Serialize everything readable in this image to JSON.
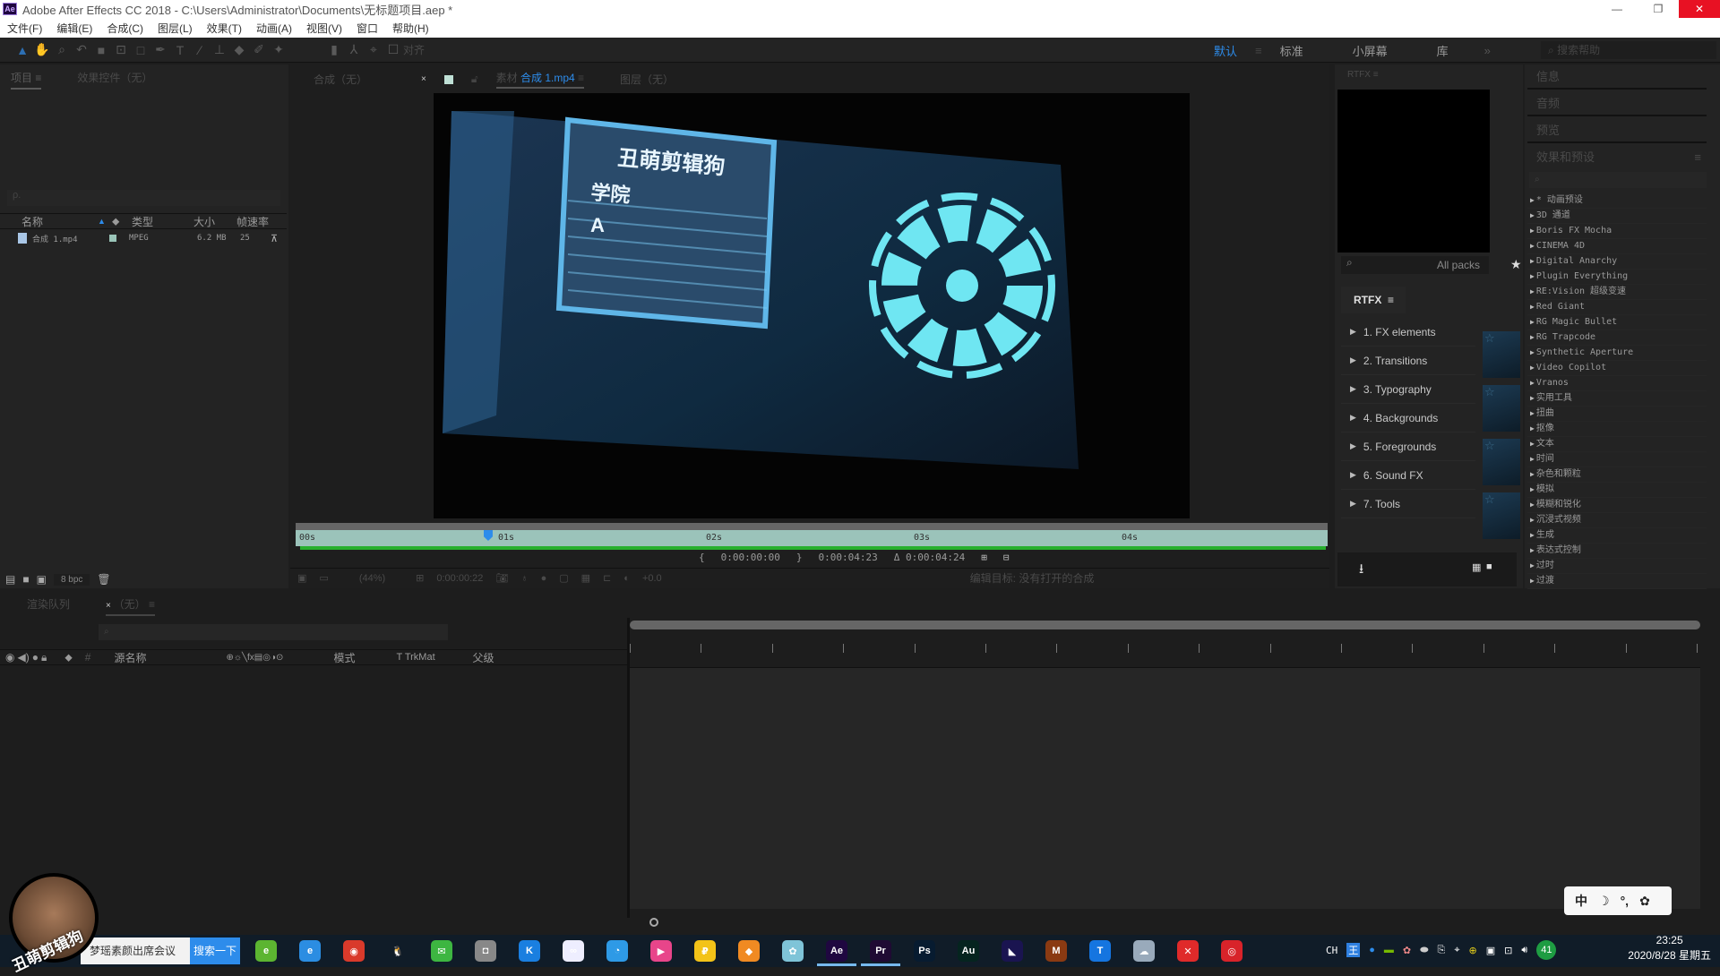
{
  "window": {
    "title": "Adobe After Effects CC 2018 - C:\\Users\\Administrator\\Documents\\无标题项目.aep *",
    "app_badge": "Ae",
    "controls": [
      "—",
      "❐",
      "✕"
    ]
  },
  "menu": [
    "文件(F)",
    "编辑(E)",
    "合成(C)",
    "图层(L)",
    "效果(T)",
    "动画(A)",
    "视图(V)",
    "窗口",
    "帮助(H)"
  ],
  "toolbar": {
    "align_label": "对齐",
    "workspaces": [
      "默认",
      "标准",
      "小屏幕",
      "库"
    ],
    "active_workspace": "默认",
    "more": "»",
    "search_help_placeholder": "搜索帮助"
  },
  "project_panel": {
    "tabs": [
      "项目",
      "效果控件（无）"
    ],
    "search_placeholder": "ρ.",
    "columns": [
      "名称",
      "类型",
      "大小",
      "帧速率"
    ],
    "rows": [
      {
        "name": "合成 1.mp4",
        "type": "MPEG",
        "size": "6.2 MB",
        "fps": "25"
      }
    ],
    "bpc": "8 bpc"
  },
  "viewer": {
    "tabs": {
      "comp": "合成（无）",
      "footage_prefix": "素材",
      "footage_name": "合成 1.mp4",
      "layer": "图层（无）"
    },
    "video_text": [
      "丑萌剪辑狗",
      "学院",
      "A"
    ],
    "ruler_labels": [
      "00s",
      "01s",
      "02s",
      "03s",
      "04s"
    ],
    "playhead_seconds": 0.88,
    "in_point": "0:00:00:00",
    "out_point": "0:00:04:23",
    "duration": "Δ 0:00:04:24",
    "zoom": "(44%)",
    "current_time": "0:00:00:22",
    "exposure": "+0.0",
    "edit_target": "编辑目标: 没有打开的合成"
  },
  "rtfx": {
    "title": "RTFX",
    "search_placeholder": "All packs",
    "brand": "RTFX",
    "items": [
      "1. FX elements",
      "2. Transitions",
      "3. Typography",
      "4. Backgrounds",
      "5. Foregrounds",
      "6. Sound FX",
      "7. Tools"
    ]
  },
  "right_panel": {
    "sections": [
      "信息",
      "音频",
      "预览",
      "效果和预设"
    ],
    "effects": [
      "* 动画预设",
      "3D 通道",
      "Boris FX Mocha",
      "CINEMA 4D",
      "Digital Anarchy",
      "Plugin Everything",
      "RE:Vision 超级变速",
      "Red Giant",
      "RG Magic Bullet",
      "RG Trapcode",
      "Synthetic Aperture",
      "Video Copilot",
      "Vranos",
      "实用工具",
      "扭曲",
      "抠像",
      "文本",
      "时间",
      "杂色和颗粒",
      "模拟",
      "模糊和锐化",
      "沉浸式视频",
      "生成",
      "表达式控制",
      "过时",
      "过渡"
    ]
  },
  "timeline": {
    "tabs": [
      "渲染队列",
      "（无）"
    ],
    "columns": {
      "source": "源名称",
      "mode": "模式",
      "trkmat": "T  TrkMat",
      "parent": "父级",
      "num": "#"
    }
  },
  "taskbar": {
    "avatar_caption": "丑萌剪辑狗",
    "search_text": "梦瑶素颜出席会议",
    "search_button": "搜索一下",
    "apps": [
      {
        "name": "360-browser",
        "label": "e",
        "color": "#5cb531"
      },
      {
        "name": "ie",
        "label": "e",
        "color": "#2b8de2"
      },
      {
        "name": "chrome",
        "label": "◉",
        "color": "#d93a2b"
      },
      {
        "name": "qq",
        "label": "🐧",
        "color": "#101c28"
      },
      {
        "name": "wechat",
        "label": "✉",
        "color": "#3db641"
      },
      {
        "name": "camera",
        "label": "◘",
        "color": "#888"
      },
      {
        "name": "kugou",
        "label": "K",
        "color": "#1a7fe0"
      },
      {
        "name": "baidu-netdisk",
        "label": "∞",
        "color": "#eef"
      },
      {
        "name": "qq-browser",
        "label": "◔",
        "color": "#2e9ae6"
      },
      {
        "name": "youku",
        "label": "▶",
        "color": "#e8458a"
      },
      {
        "name": "app-yellow",
        "label": "₽",
        "color": "#f3c318"
      },
      {
        "name": "app-orange",
        "label": "◆",
        "color": "#f08a22"
      },
      {
        "name": "app-flower",
        "label": "✿",
        "color": "#7fc4d8"
      },
      {
        "name": "after-effects",
        "label": "Ae",
        "color": "#1f0740",
        "active": true
      },
      {
        "name": "premiere",
        "label": "Pr",
        "color": "#1f0a33",
        "active": true
      },
      {
        "name": "photoshop",
        "label": "Ps",
        "color": "#071b30"
      },
      {
        "name": "audition",
        "label": "Au",
        "color": "#05241f"
      },
      {
        "name": "media-encoder",
        "label": "◣",
        "color": "#1a1450"
      },
      {
        "name": "app-m",
        "label": "M",
        "color": "#8a3a12"
      },
      {
        "name": "app-t",
        "label": "T",
        "color": "#1575e0"
      },
      {
        "name": "cloud",
        "label": "☁",
        "color": "#9ab"
      },
      {
        "name": "xmind",
        "label": "✕",
        "color": "#e02a2a"
      },
      {
        "name": "netease-music",
        "label": "◎",
        "color": "#d8232a"
      }
    ],
    "tray_lang": "CH",
    "battery_badge": "41",
    "time": "23:25",
    "date": "2020/8/28 星期五"
  },
  "ime": {
    "items": [
      "中",
      "☽",
      "°,",
      "✿"
    ]
  }
}
